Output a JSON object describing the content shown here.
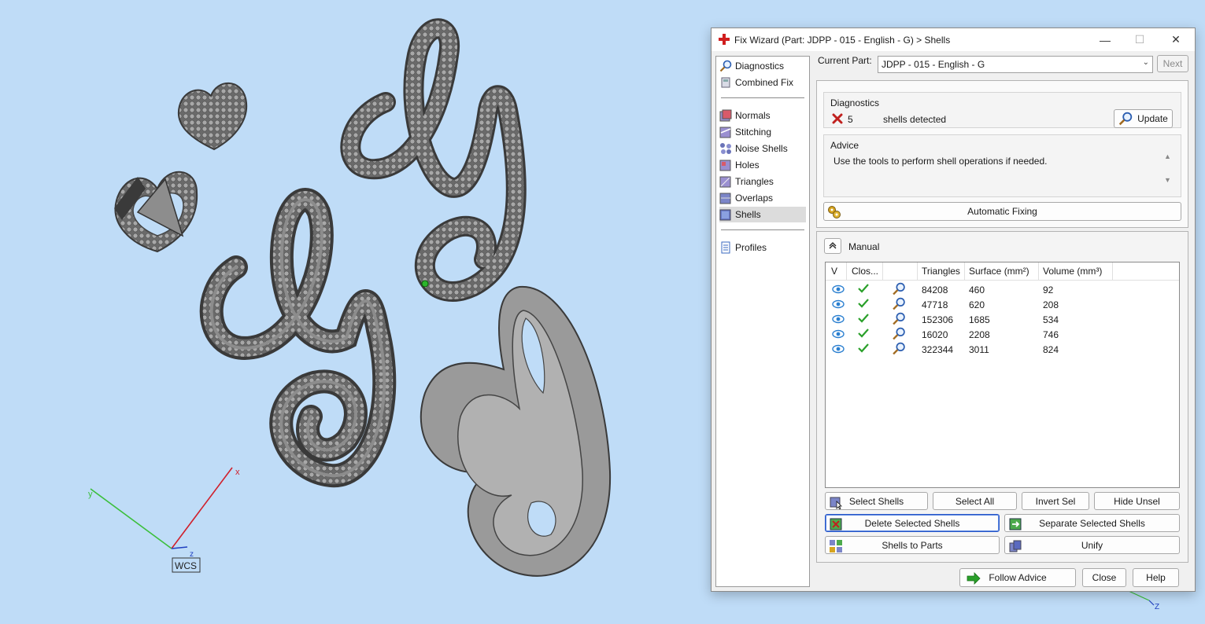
{
  "viewport": {
    "axis_x_label": "x",
    "axis_y_label": "y",
    "axis_z_label": "z",
    "wcs_label": "WCS",
    "corner_axis_label": "Z"
  },
  "window": {
    "title": "Fix Wizard (Part: JDPP - 015 - English - G) > Shells",
    "minimize": "—",
    "maximize": "☐",
    "close": "✕"
  },
  "nav": {
    "top": [
      {
        "label": "Diagnostics",
        "icon": "magnifier-icon"
      },
      {
        "label": "Combined Fix",
        "icon": "combined-fix-icon"
      }
    ],
    "tools": [
      {
        "label": "Normals",
        "icon": "normals-icon"
      },
      {
        "label": "Stitching",
        "icon": "stitching-icon"
      },
      {
        "label": "Noise Shells",
        "icon": "noise-shells-icon"
      },
      {
        "label": "Holes",
        "icon": "holes-icon"
      },
      {
        "label": "Triangles",
        "icon": "triangles-icon"
      },
      {
        "label": "Overlaps",
        "icon": "overlaps-icon"
      },
      {
        "label": "Shells",
        "icon": "shells-icon",
        "selected": true
      }
    ],
    "bottom": [
      {
        "label": "Profiles",
        "icon": "profiles-icon"
      }
    ]
  },
  "current_part": {
    "label": "Current Part:",
    "value": "JDPP - 015 - English - G",
    "next_label": "Next"
  },
  "diagnostics": {
    "heading": "Diagnostics",
    "count": "5",
    "text": "shells detected",
    "update_label": "Update"
  },
  "advice": {
    "heading": "Advice",
    "text": "Use the tools to perform shell operations if needed."
  },
  "automatic_fixing_label": "Automatic Fixing",
  "manual": {
    "heading": "Manual",
    "columns": [
      "V",
      "Clos...",
      "",
      "Triangles",
      "Surface (mm²)",
      "Volume (mm³)"
    ],
    "rows": [
      {
        "triangles": "84208",
        "surface": "460",
        "volume": "92"
      },
      {
        "triangles": "47718",
        "surface": "620",
        "volume": "208"
      },
      {
        "triangles": "152306",
        "surface": "1685",
        "volume": "534"
      },
      {
        "triangles": "16020",
        "surface": "2208",
        "volume": "746"
      },
      {
        "triangles": "322344",
        "surface": "3011",
        "volume": "824"
      }
    ],
    "buttons": {
      "select_shells": "Select Shells",
      "select_all": "Select All",
      "invert_sel": "Invert Sel",
      "hide_unsel": "Hide Unsel",
      "delete_selected": "Delete Selected Shells",
      "separate_selected": "Separate Selected Shells",
      "shells_to_parts": "Shells to Parts",
      "unify": "Unify"
    }
  },
  "footer": {
    "follow_advice": "Follow Advice",
    "close": "Close",
    "help": "Help"
  },
  "colors": {
    "background": "#bfdcf7",
    "accent_focus": "#2a59c9",
    "error_red": "#c0201e",
    "check_green": "#2aa02a"
  }
}
